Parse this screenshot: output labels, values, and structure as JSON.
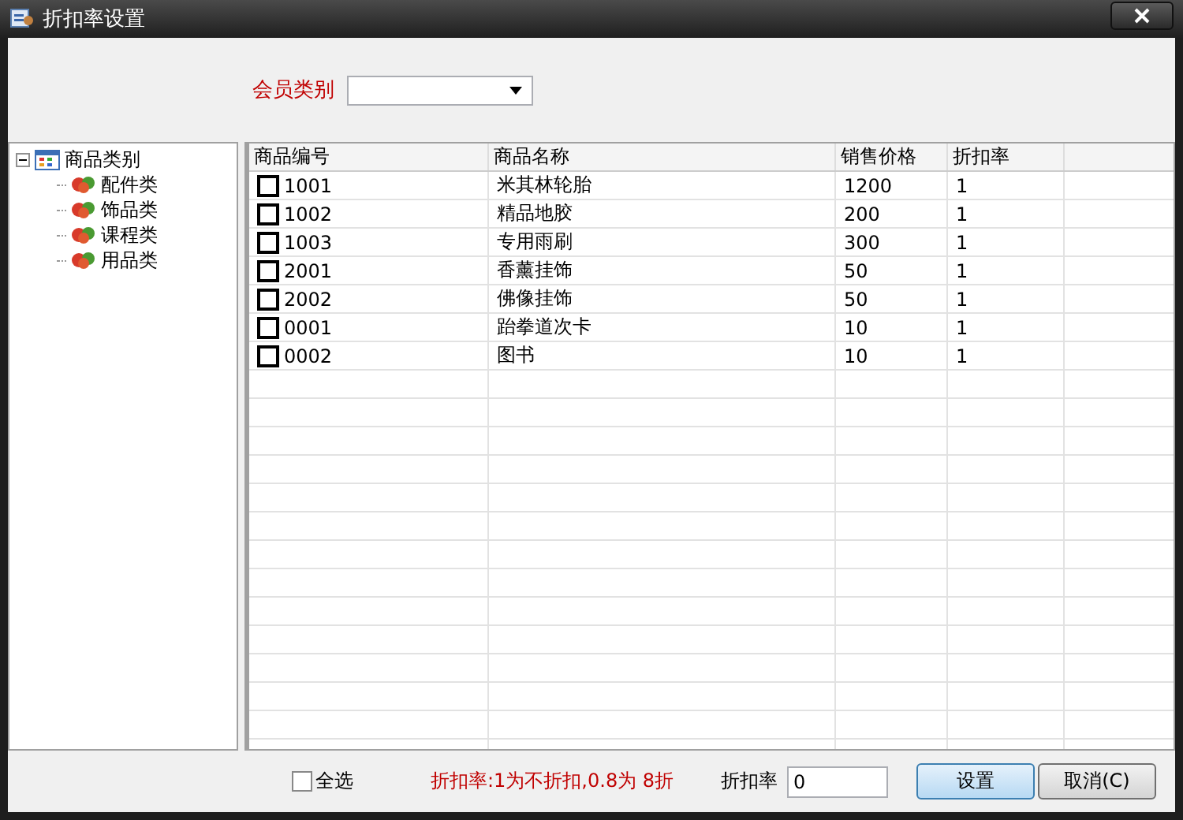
{
  "window": {
    "title": "折扣率设置"
  },
  "member_type": {
    "label": "会员类别"
  },
  "tree": {
    "label": "商品类别",
    "expanded": true,
    "children": [
      {
        "label": "配件类"
      },
      {
        "label": "饰品类"
      },
      {
        "label": "课程类"
      },
      {
        "label": "用品类"
      }
    ]
  },
  "table": {
    "columns": [
      "商品编号",
      "商品名称",
      "销售价格",
      "折扣率"
    ],
    "rows": [
      {
        "code": "1001",
        "name": "米其林轮胎",
        "price": "1200",
        "rate": "1",
        "checked": false
      },
      {
        "code": "1002",
        "name": "精品地胶",
        "price": "200",
        "rate": "1",
        "checked": false
      },
      {
        "code": "1003",
        "name": "专用雨刷",
        "price": "300",
        "rate": "1",
        "checked": false
      },
      {
        "code": "2001",
        "name": "香薰挂饰",
        "price": "50",
        "rate": "1",
        "checked": false
      },
      {
        "code": "2002",
        "name": "佛像挂饰",
        "price": "50",
        "rate": "1",
        "checked": false
      },
      {
        "code": "0001",
        "name": "跆拳道次卡",
        "price": "10",
        "rate": "1",
        "checked": false
      },
      {
        "code": "0002",
        "name": "图书",
        "price": "10",
        "rate": "1",
        "checked": false
      }
    ]
  },
  "footer": {
    "select_all": {
      "label": "全选",
      "checked": false
    },
    "hint": "折扣率:1为不折扣,0.8为 8折",
    "rate_label": "折扣率",
    "rate_value": "0",
    "buttons": [
      {
        "label": "设置",
        "kind": "default"
      },
      {
        "label": "取消(C)",
        "kind": "normal"
      }
    ]
  }
}
